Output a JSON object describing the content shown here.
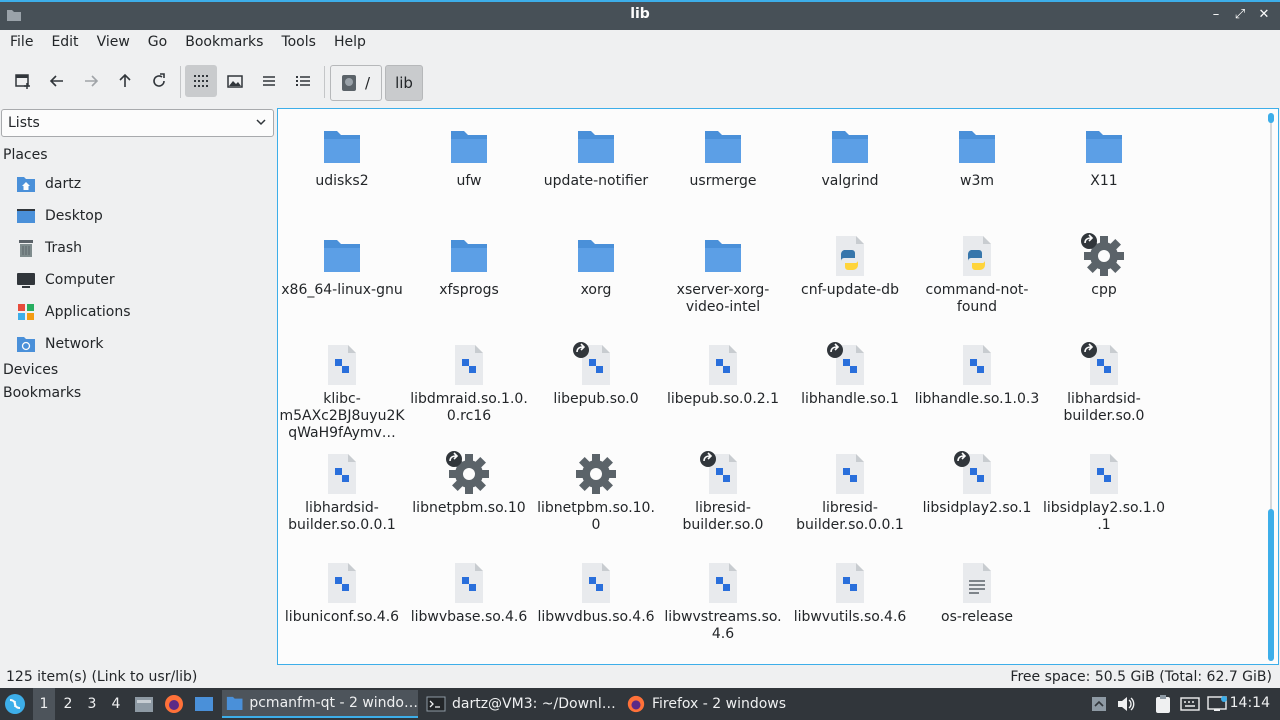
{
  "window": {
    "title": "lib"
  },
  "menu": [
    "File",
    "Edit",
    "View",
    "Go",
    "Bookmarks",
    "Tools",
    "Help"
  ],
  "path": {
    "root": "/",
    "current": "lib"
  },
  "side": {
    "combo": "Lists",
    "places_header": "Places",
    "places": [
      {
        "label": "dartz",
        "icon": "home-folder-icon"
      },
      {
        "label": "Desktop",
        "icon": "desktop-icon"
      },
      {
        "label": "Trash",
        "icon": "trash-icon"
      },
      {
        "label": "Computer",
        "icon": "computer-icon"
      },
      {
        "label": "Applications",
        "icon": "applications-icon"
      },
      {
        "label": "Network",
        "icon": "network-icon"
      }
    ],
    "devices_header": "Devices",
    "bookmarks_header": "Bookmarks"
  },
  "files": [
    {
      "name": "udisks2",
      "type": "folder"
    },
    {
      "name": "ufw",
      "type": "folder"
    },
    {
      "name": "update-notifier",
      "type": "folder"
    },
    {
      "name": "usrmerge",
      "type": "folder"
    },
    {
      "name": "valgrind",
      "type": "folder"
    },
    {
      "name": "w3m",
      "type": "folder"
    },
    {
      "name": "X11",
      "type": "folder"
    },
    {
      "name": "x86_64-linux-gnu",
      "type": "folder"
    },
    {
      "name": "xfsprogs",
      "type": "folder"
    },
    {
      "name": "xorg",
      "type": "folder"
    },
    {
      "name": "xserver-xorg-video-intel",
      "type": "folder"
    },
    {
      "name": "cnf-update-db",
      "type": "python"
    },
    {
      "name": "command-not-found",
      "type": "python"
    },
    {
      "name": "cpp",
      "type": "gear-link"
    },
    {
      "name": "klibc-m5AXc2BJ8uyu2KqWaH9fAymv…",
      "type": "lib"
    },
    {
      "name": "libdmraid.so.1.0.0.rc16",
      "type": "lib"
    },
    {
      "name": "libepub.so.0",
      "type": "lib-link"
    },
    {
      "name": "libepub.so.0.2.1",
      "type": "lib"
    },
    {
      "name": "libhandle.so.1",
      "type": "lib-link"
    },
    {
      "name": "libhandle.so.1.0.3",
      "type": "lib"
    },
    {
      "name": "libhardsid-builder.so.0",
      "type": "lib-link"
    },
    {
      "name": "libhardsid-builder.so.0.0.1",
      "type": "lib"
    },
    {
      "name": "libnetpbm.so.10",
      "type": "gear-link"
    },
    {
      "name": "libnetpbm.so.10.0",
      "type": "gear"
    },
    {
      "name": "libresid-builder.so.0",
      "type": "lib-link"
    },
    {
      "name": "libresid-builder.so.0.0.1",
      "type": "lib"
    },
    {
      "name": "libsidplay2.so.1",
      "type": "lib-link"
    },
    {
      "name": "libsidplay2.so.1.0.1",
      "type": "lib"
    },
    {
      "name": "libuniconf.so.4.6",
      "type": "lib"
    },
    {
      "name": "libwvbase.so.4.6",
      "type": "lib"
    },
    {
      "name": "libwvdbus.so.4.6",
      "type": "lib"
    },
    {
      "name": "libwvstreams.so.4.6",
      "type": "lib"
    },
    {
      "name": "libwvutils.so.4.6",
      "type": "lib"
    },
    {
      "name": "os-release",
      "type": "text"
    }
  ],
  "status": {
    "left": "125 item(s) (Link to usr/lib)",
    "right": "Free space: 50.5 GiB (Total: 62.7 GiB)"
  },
  "taskbar": {
    "desktops": [
      "1",
      "2",
      "3",
      "4"
    ],
    "tasks": [
      {
        "label": "pcmanfm-qt - 2 windo…",
        "icon": "folder-icon"
      },
      {
        "label": "dartz@VM3: ~/Downl…",
        "icon": "terminal-icon"
      },
      {
        "label": "Firefox - 2 windows",
        "icon": "firefox-icon"
      }
    ],
    "clock": "14:14"
  },
  "colors": {
    "accent": "#3daee9",
    "folder": "#4a90d9",
    "titlebar": "#475057",
    "taskbar": "#31363b"
  }
}
